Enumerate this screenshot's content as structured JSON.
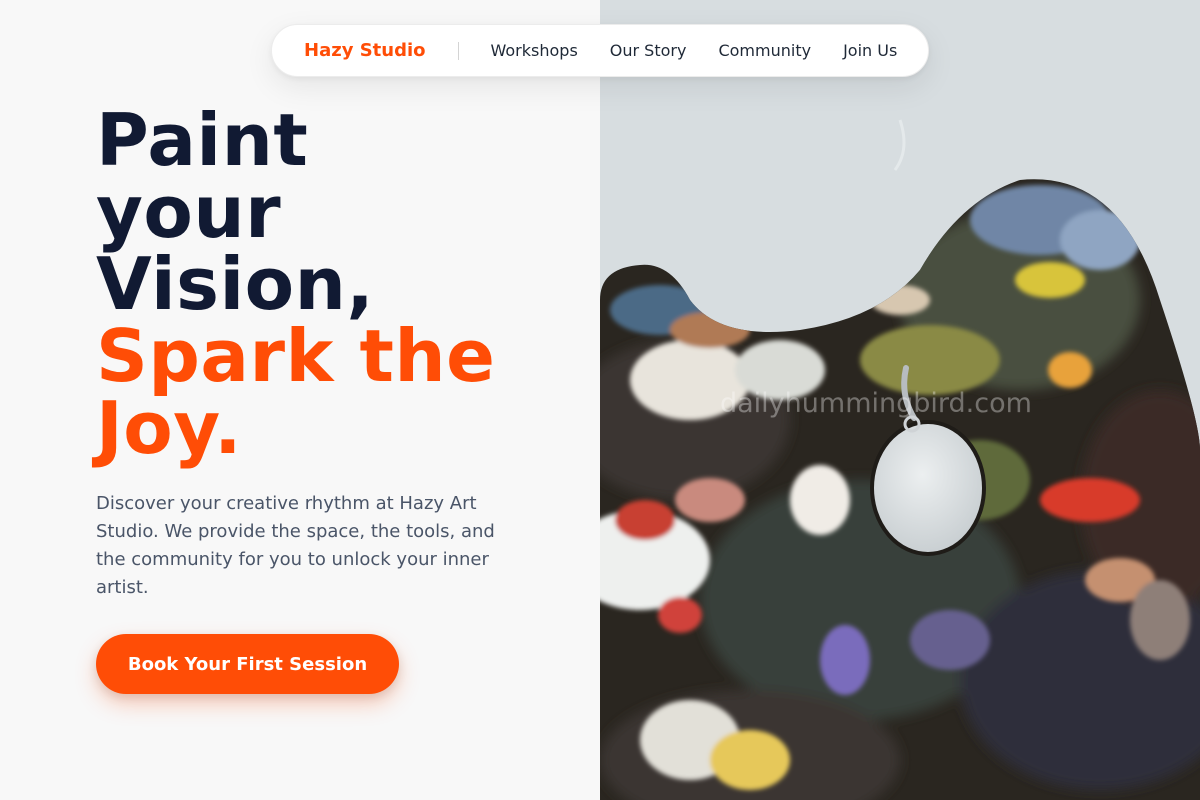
{
  "nav": {
    "brand": "Hazy Studio",
    "links": [
      {
        "label": "Workshops"
      },
      {
        "label": "Our Story"
      },
      {
        "label": "Community"
      },
      {
        "label": "Join Us"
      }
    ]
  },
  "hero": {
    "headline_dark": [
      "Paint",
      "your",
      "Vision,"
    ],
    "headline_accent": [
      "Spark the",
      "Joy."
    ],
    "description": "Discover your creative rhythm at Hazy Art Studio. We provide the space, the tools, and the community for you to unlock your inner artist.",
    "cta_label": "Book Your First Session"
  },
  "image": {
    "watermark": "dailyhummingbird.com"
  },
  "colors": {
    "accent": "#ff4d06",
    "headline": "#111a33",
    "body_text": "#4a5568",
    "background": "#f8f8f8"
  }
}
